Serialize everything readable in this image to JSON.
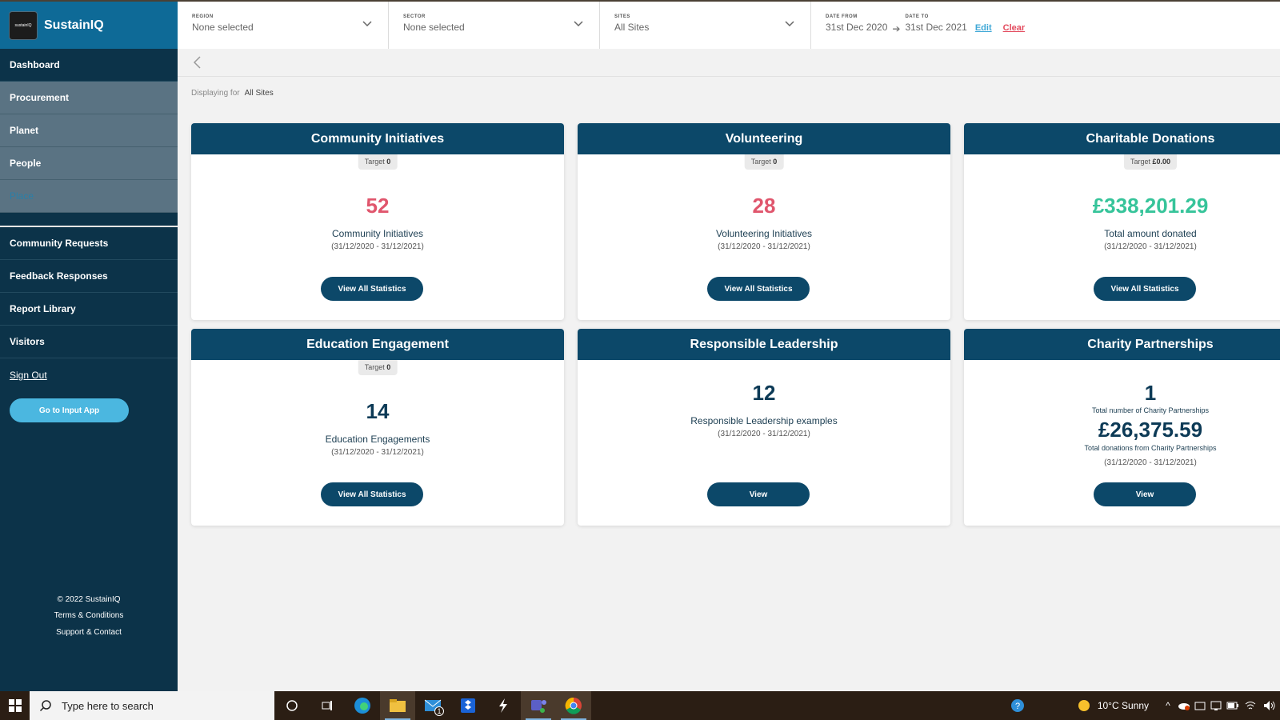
{
  "brand": {
    "name": "SustainIQ",
    "logo_text": "sustainIQ"
  },
  "sidebar": {
    "items": [
      {
        "label": "Dashboard"
      },
      {
        "label": "Procurement"
      },
      {
        "label": "Planet"
      },
      {
        "label": "People"
      },
      {
        "label": "Place"
      },
      {
        "label": "Community Requests"
      },
      {
        "label": "Feedback Responses"
      },
      {
        "label": "Report Library"
      },
      {
        "label": "Visitors"
      },
      {
        "label": "Sign Out"
      }
    ],
    "input_app_button": "Go to Input App",
    "footer": {
      "copyright": "© 2022 SustainIQ",
      "terms": "Terms & Conditions",
      "support": "Support & Contact"
    }
  },
  "filters": {
    "region": {
      "label": "REGION",
      "value": "None selected"
    },
    "sector": {
      "label": "SECTOR",
      "value": "None selected"
    },
    "sites": {
      "label": "SITES",
      "value": "All Sites"
    },
    "date_from": {
      "label": "DATE FROM",
      "value": "31st Dec 2020"
    },
    "date_to": {
      "label": "DATE TO",
      "value": "31st Dec 2021"
    },
    "edit_label": "Edit",
    "clear_label": "Clear"
  },
  "displaying": {
    "prefix": "Displaying for",
    "value": "All Sites"
  },
  "cards": {
    "community": {
      "title": "Community Initiatives",
      "target_label": "Target",
      "target_value": "0",
      "value": "52",
      "label": "Community Initiatives",
      "range": "(31/12/2020 - 31/12/2021)",
      "button": "View All Statistics"
    },
    "volunteering": {
      "title": "Volunteering",
      "target_label": "Target",
      "target_value": "0",
      "value": "28",
      "label": "Volunteering Initiatives",
      "range": "(31/12/2020 - 31/12/2021)",
      "button": "View All Statistics"
    },
    "donations": {
      "title": "Charitable Donations",
      "target_label": "Target",
      "target_value": "£0.00",
      "value": "£338,201.29",
      "label": "Total amount donated",
      "range": "(31/12/2020 - 31/12/2021)",
      "button": "View All Statistics"
    },
    "education": {
      "title": "Education Engagement",
      "target_label": "Target",
      "target_value": "0",
      "value": "14",
      "label": "Education Engagements",
      "range": "(31/12/2020 - 31/12/2021)",
      "button": "View All Statistics"
    },
    "leadership": {
      "title": "Responsible Leadership",
      "value": "12",
      "label": "Responsible Leadership examples",
      "range": "(31/12/2020 - 31/12/2021)",
      "button": "View"
    },
    "partnerships": {
      "title": "Charity Partnerships",
      "value": "1",
      "label": "Total number of Charity Partnerships",
      "value2": "£26,375.59",
      "label2": "Total donations from Charity Partnerships",
      "range": "(31/12/2020 - 31/12/2021)",
      "button": "View"
    }
  },
  "taskbar": {
    "search_placeholder": "Type here to search",
    "mail_badge": "1",
    "weather": "10°C  Sunny"
  }
}
